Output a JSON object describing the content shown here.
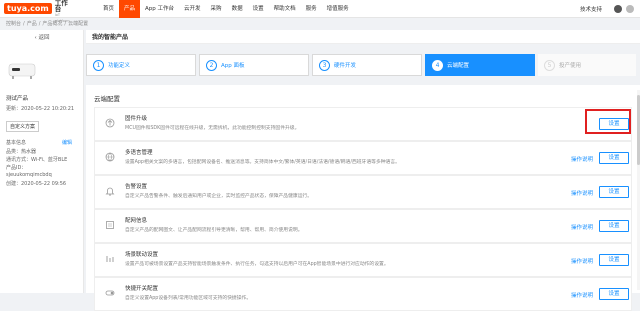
{
  "topbar": {
    "logo_mark": "tuya.com",
    "logo_title": "IoT 工作台",
    "logo_sub": "IoT platform",
    "nav": [
      "首页",
      "产品",
      "App 工作台",
      "云开发",
      "采购",
      "数据",
      "设置",
      "帮助文档",
      "服务",
      "增值服务"
    ],
    "active_index": 1,
    "tech_support": "技术支持"
  },
  "breadcrumb": [
    "控制台",
    "/",
    "产品",
    "/",
    "产品概况",
    "/",
    "云端配置"
  ],
  "left_panel": {
    "back": "‹ 返回",
    "product_name": "测试产品",
    "updated": "更新：2020-05-22 10:20:21",
    "custom_btn": "自定义方案",
    "basic_info": "基本信息",
    "edit": "编辑",
    "category": "品类：热水器",
    "protocol": "通讯方式：Wi-Fi、蓝牙BLE",
    "pid_label": "产品ID：",
    "pid": "sjeuukomqimcbdq",
    "created": "创建：2020-05-22 09:56"
  },
  "main": {
    "title": "我的智能产品",
    "steps": [
      {
        "num": "1",
        "label": "功能定义"
      },
      {
        "num": "2",
        "label": "App 面板"
      },
      {
        "num": "3",
        "label": "硬件开发"
      },
      {
        "num": "4",
        "label": "云端配置"
      },
      {
        "num": "5",
        "label": "投产使用"
      }
    ],
    "active_step": 3,
    "section_title": "云端配置",
    "rows": [
      {
        "title": "固件升级",
        "desc": "MCU固件和SDK固件可远程在线升级，无需拆机，此功能控制控制支持固件升级。",
        "link": "",
        "button": "设置"
      },
      {
        "title": "多语言管理",
        "desc": "设置App相关文案的多语言，包括配网设备名、推送消息等。支持简体中文/繁体/英语/日语/法语/德语/韩语/西班牙语等多种语言。",
        "link": "操作说明",
        "button": "设置"
      },
      {
        "title": "告警设置",
        "desc": "自定义产品告警条件、触发后通知用户或企业，实时监控产品状态，保障产品健康运行。",
        "link": "操作说明",
        "button": "设置"
      },
      {
        "title": "配网信息",
        "desc": "自定义产品的配网图文、让产品配网流程引导更清晰，帮用、帮用、简介使用说明。",
        "link": "操作说明",
        "button": "设置"
      },
      {
        "title": "场景联动设置",
        "desc": "设置产品可被场景设置产品支持智能场景触发条件、执行任务，勾选支持以后用户可在App智能场景中进行对应动作的设置。",
        "link": "操作说明",
        "button": "设置"
      },
      {
        "title": "快捷开关配置",
        "desc": "自定义设置App设备列表/常用功能区域可支持的快捷操作。",
        "link": "操作说明",
        "button": "设置"
      }
    ]
  },
  "colors": {
    "brand": "#ff4800",
    "primary": "#1890ff",
    "highlight": "#e02020"
  }
}
